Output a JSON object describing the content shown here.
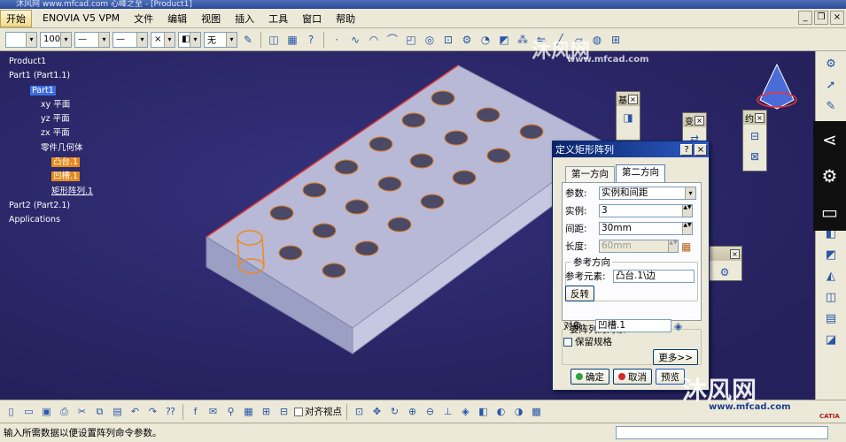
{
  "window": {
    "title": "沐风网 www.mfcad.com 心峰之至 - [Product1]"
  },
  "menu": {
    "start": "开始",
    "items": [
      "ENOVIA V5 VPM",
      "文件",
      "编辑",
      "视图",
      "插入",
      "工具",
      "窗口",
      "帮助"
    ]
  },
  "toolbar": {
    "zoom": "100%",
    "layer": "无"
  },
  "tree": {
    "nodes": [
      "Product1",
      "Part1 (Part1.1)",
      "Part1",
      "xy 平面",
      "yz 平面",
      "zx 平面",
      "零件几何体",
      "凸台.1",
      "凹槽.1",
      "矩形阵列.1",
      "Part2 (Part2.1)",
      "Applications"
    ]
  },
  "palettes": {
    "p1": "基",
    "p2": "变",
    "p3": "约"
  },
  "dialog": {
    "title": "定义矩形阵列",
    "help": "?",
    "close": "×",
    "tabs": [
      "第一方向",
      "第二方向"
    ],
    "params_label": "参数:",
    "params_value": "实例和间距",
    "instances_label": "实例:",
    "instances_value": "3",
    "spacing_label": "间距:",
    "spacing_value": "30mm",
    "length_label": "长度:",
    "length_value": "60mm",
    "ref_dir_title": "参考方向",
    "ref_elem_label": "参考元素:",
    "ref_elem_value": "凸台.1\\边",
    "reverse_btn": "反转",
    "object_group_title": "要阵列的对象",
    "object_label": "对象:",
    "object_value": "凹槽.1",
    "keep_spec_label": "保留规格",
    "more_btn": "更多>>",
    "ok_btn": "确定",
    "cancel_btn": "取消",
    "preview_btn": "预览"
  },
  "bottombar": {
    "align_view": "对齐视点"
  },
  "status": {
    "text": "输入所需数据以便设置阵列命令参数。"
  },
  "watermarks": {
    "top": "沐风网",
    "top_url": "www.mfcad.com",
    "bottom": "沐风网",
    "bottom_url": "www.mfcad.com",
    "catia": "CATIA"
  }
}
